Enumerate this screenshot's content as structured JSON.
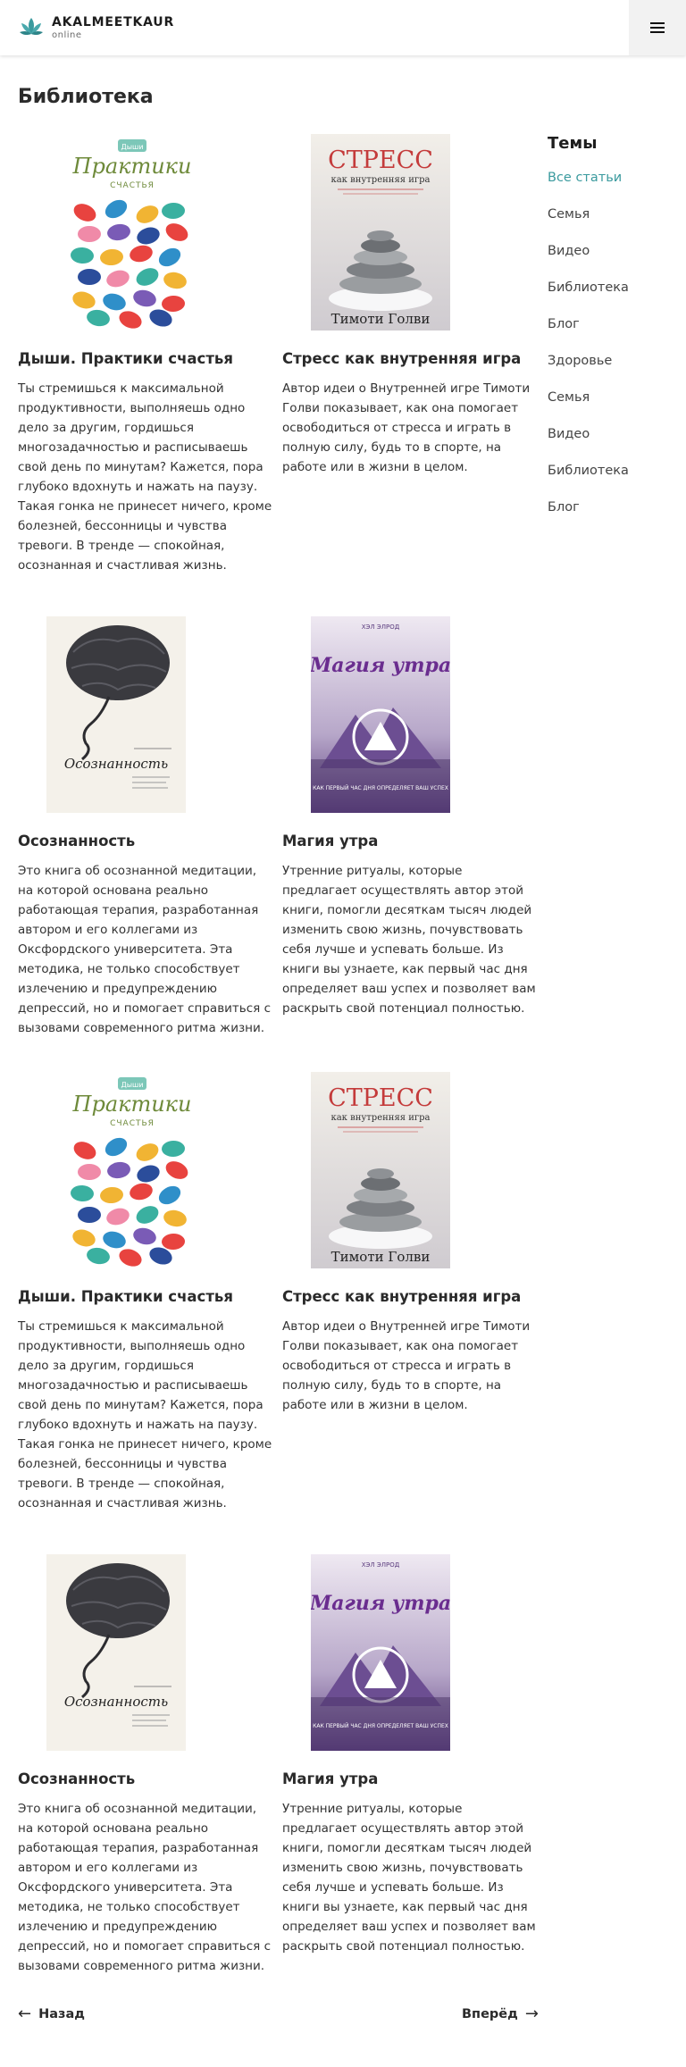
{
  "header": {
    "logo_title": "AKALMEETKAUR",
    "logo_subtitle": "online",
    "menu_icon": "hamburger-icon"
  },
  "page": {
    "title": "Библиотека"
  },
  "colors": {
    "accent": "#3a9a9e",
    "text": "#2a2a2a",
    "menu_bg": "#f2f2f2"
  },
  "books": [
    {
      "title": "Дыши. Практики счастья",
      "cover": {
        "kind": "practices",
        "top_tag": "Дыши",
        "title": "Практики",
        "subtitle": "СЧАСТЬЯ"
      },
      "lines": [
        "Ты стремишься к максимальной",
        "продуктивности, выполняешь одно",
        "дело за другим, гордишься",
        "многозадачностью и расписываешь",
        "свой день по минутам?  Кажется, пора",
        "глубоко вдохнуть и нажать на паузу.",
        "Такая гонка не принесет ничего, кроме",
        "болезней, бессонницы и чувства",
        "тревоги.  В тренде — спокойная,",
        "осознанная и счастливая жизнь."
      ]
    },
    {
      "title": "Стресс как внутренняя игра",
      "cover": {
        "kind": "stress",
        "title": "СТРЕСС",
        "subtitle": "как внутренняя игра",
        "author": "Тимоти Голви"
      },
      "lines": [
        "Автор идеи о  Внутренней игре Тимоти",
        "Голви показывает, как она помогает",
        "освободиться от стресса и играть в",
        "полную силу, будь то в спорте, на",
        "работе или в жизни в целом."
      ]
    },
    {
      "title": "Осознанность",
      "cover": {
        "kind": "mindful",
        "title": "Осознанность"
      },
      "lines": [
        "Это книга об осознанной медитации,",
        "на которой основана реально",
        "работающая терапия, разработанная",
        "автором и его коллегами из",
        "Оксфордского университета. Эта",
        "методика, не только способствует",
        "излечению и предупреждению",
        "депрессий, но и помогает справиться с",
        "вызовами современного ритма жизни."
      ]
    },
    {
      "title": "Магия утра",
      "cover": {
        "kind": "morning",
        "author": "ХЭЛ ЭЛРОД",
        "title": "Магия утра",
        "tagline": "КАК ПЕРВЫЙ ЧАС ДНЯ ОПРЕДЕЛЯЕТ ВАШ УСПЕХ"
      },
      "lines": [
        "Утренние ритуалы, которые",
        "предлагает осуществлять автор этой",
        "книги, помогли десяткам тысяч людей",
        "изменить свою жизнь, почувствовать",
        "себя лучше и успевать больше.  Из",
        "книги вы узнаете, как первый час дня",
        "определяет ваш успех и позволяет вам",
        "раскрыть свой потенциал полностью."
      ]
    },
    {
      "title": "Дыши. Практики счастья",
      "cover": {
        "kind": "practices",
        "top_tag": "Дыши",
        "title": "Практики",
        "subtitle": "СЧАСТЬЯ"
      },
      "lines": [
        "Ты стремишься к максимальной",
        "продуктивности, выполняешь одно",
        "дело за другим, гордишься",
        "многозадачностью и расписываешь",
        "свой день по минутам?  Кажется, пора",
        "глубоко вдохнуть и нажать на паузу.",
        "Такая гонка не принесет ничего, кроме",
        "болезней, бессонницы и чувства",
        "тревоги.  В тренде — спокойная,",
        "осознанная и счастливая жизнь."
      ]
    },
    {
      "title": "Стресс как внутренняя игра",
      "cover": {
        "kind": "stress",
        "title": "СТРЕСС",
        "subtitle": "как внутренняя игра",
        "author": "Тимоти Голви"
      },
      "lines": [
        "Автор идеи о  Внутренней игре Тимоти",
        "Голви показывает, как она помогает",
        "освободиться от стресса и играть в",
        "полную силу, будь то в спорте, на",
        "работе или в жизни в целом."
      ]
    },
    {
      "title": "Осознанность",
      "cover": {
        "kind": "mindful",
        "title": "Осознанность"
      },
      "lines": [
        "Это книга об осознанной медитации,",
        "на которой основана реально",
        "работающая терапия, разработанная",
        "автором и его коллегами из",
        "Оксфордского университета. Эта",
        "методика, не только способствует",
        "излечению и предупреждению",
        "депрессий, но и помогает справиться с",
        "вызовами современного ритма жизни."
      ]
    },
    {
      "title": "Магия утра",
      "cover": {
        "kind": "morning",
        "author": "ХЭЛ ЭЛРОД",
        "title": "Магия утра",
        "tagline": "КАК ПЕРВЫЙ ЧАС ДНЯ ОПРЕДЕЛЯЕТ ВАШ УСПЕХ"
      },
      "lines": [
        "Утренние ритуалы, которые",
        "предлагает осуществлять автор этой",
        "книги, помогли десяткам тысяч людей",
        "изменить свою жизнь, почувствовать",
        "себя лучше и успевать больше.  Из",
        "книги вы узнаете, как первый час дня",
        "определяет ваш успех и позволяет вам",
        "раскрыть свой потенциал полностью."
      ]
    }
  ],
  "topics": {
    "title": "Темы",
    "items": [
      "Все статьи",
      "Семья",
      "Видео",
      "Библиотека",
      "Блог",
      "Здоровье",
      "Семья",
      "Видео",
      "Библиотека",
      "Блог"
    ],
    "active_index": 0
  },
  "pagination": {
    "prev_label": "Назад",
    "next_label": "Вперёд"
  }
}
